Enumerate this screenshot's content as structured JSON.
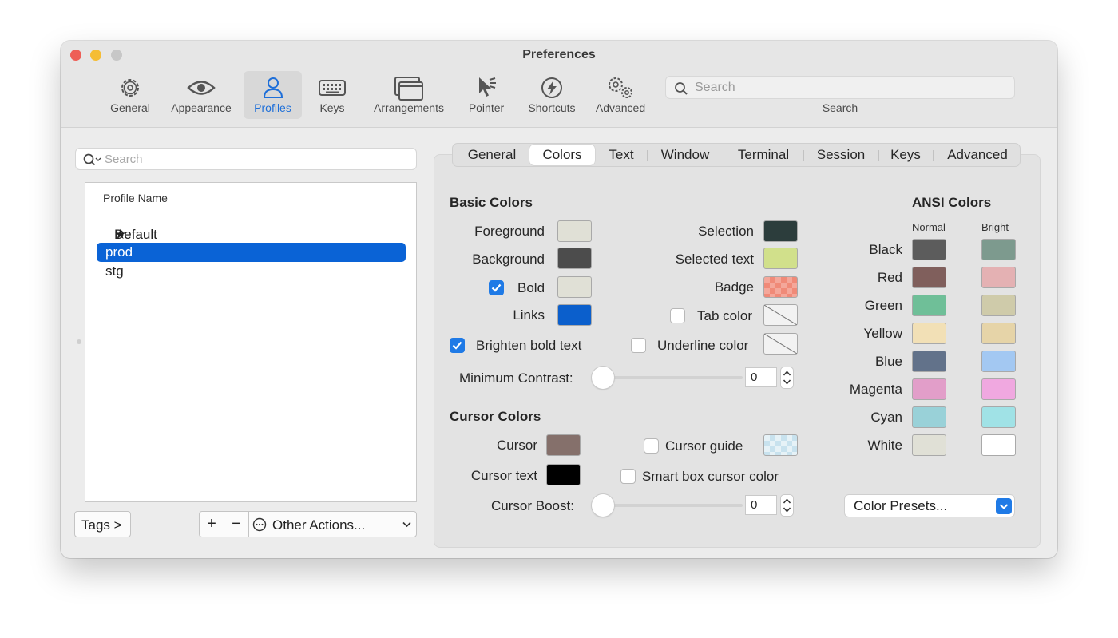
{
  "window": {
    "title": "Preferences"
  },
  "toolbar": {
    "items": [
      {
        "label": "General",
        "icon": "gear-icon"
      },
      {
        "label": "Appearance",
        "icon": "eye-icon"
      },
      {
        "label": "Profiles",
        "icon": "person-icon"
      },
      {
        "label": "Keys",
        "icon": "keyboard-icon"
      },
      {
        "label": "Arrangements",
        "icon": "windows-icon"
      },
      {
        "label": "Pointer",
        "icon": "cursor-icon"
      },
      {
        "label": "Shortcuts",
        "icon": "bolt-icon"
      },
      {
        "label": "Advanced",
        "icon": "gears-icon"
      }
    ],
    "active": "Profiles",
    "search_placeholder": "Search",
    "search_label": "Search"
  },
  "profiles": {
    "search_placeholder": "Search",
    "column_header": "Profile Name",
    "items": [
      "Default",
      "prod",
      "stg"
    ],
    "default_marker": "★",
    "selected": "prod",
    "tags_button": "Tags >",
    "add_button": "+",
    "remove_button": "−",
    "other_actions": "Other Actions..."
  },
  "tabs": {
    "items": [
      "General",
      "Colors",
      "Text",
      "Window",
      "Terminal",
      "Session",
      "Keys",
      "Advanced"
    ],
    "active": "Colors"
  },
  "basic_colors": {
    "title": "Basic Colors",
    "foreground": {
      "label": "Foreground",
      "color": "#e0e0d6"
    },
    "background": {
      "label": "Background",
      "color": "#4c4c4c"
    },
    "bold": {
      "label": "Bold",
      "color": "#e0e0d6",
      "checked": true
    },
    "links": {
      "label": "Links",
      "color": "#0b5fcc"
    },
    "brighten_bold": {
      "label": "Brighten bold text",
      "checked": true
    },
    "selection": {
      "label": "Selection",
      "color": "#2c3d3c"
    },
    "selected_text": {
      "label": "Selected text",
      "color": "#d1e08b"
    },
    "badge": {
      "label": "Badge",
      "color": "#f08a78"
    },
    "tab_color": {
      "label": "Tab color",
      "checked": false
    },
    "underline_color": {
      "label": "Underline color",
      "checked": false
    },
    "min_contrast": {
      "label": "Minimum Contrast:",
      "value": "0"
    }
  },
  "cursor_colors": {
    "title": "Cursor Colors",
    "cursor": {
      "label": "Cursor",
      "color": "#85706b"
    },
    "cursor_text": {
      "label": "Cursor text",
      "color": "#000000"
    },
    "cursor_guide": {
      "label": "Cursor guide",
      "checked": false,
      "color": "#c8e2ee"
    },
    "smart_box": {
      "label": "Smart box cursor color",
      "checked": false
    },
    "cursor_boost": {
      "label": "Cursor Boost:",
      "value": "0"
    }
  },
  "ansi": {
    "title": "ANSI Colors",
    "normal_header": "Normal",
    "bright_header": "Bright",
    "rows": [
      {
        "name": "Black",
        "normal": "#5c5c5c",
        "bright": "#7d9a8e"
      },
      {
        "name": "Red",
        "normal": "#805f5c",
        "bright": "#e4b1b3"
      },
      {
        "name": "Green",
        "normal": "#6fbf98",
        "bright": "#cfcbaa"
      },
      {
        "name": "Yellow",
        "normal": "#f2e0b6",
        "bright": "#e6d4a8"
      },
      {
        "name": "Blue",
        "normal": "#62728a",
        "bright": "#a3c8f2"
      },
      {
        "name": "Magenta",
        "normal": "#e29ec9",
        "bright": "#f0a8e0"
      },
      {
        "name": "Cyan",
        "normal": "#99d1d8",
        "bright": "#a0e2e6"
      },
      {
        "name": "White",
        "normal": "#e0e0d6",
        "bright": "#ffffff"
      }
    ],
    "presets_label": "Color Presets..."
  },
  "colors": {
    "accent": "#1f7ae6",
    "selection_blue": "#0a63d6"
  }
}
